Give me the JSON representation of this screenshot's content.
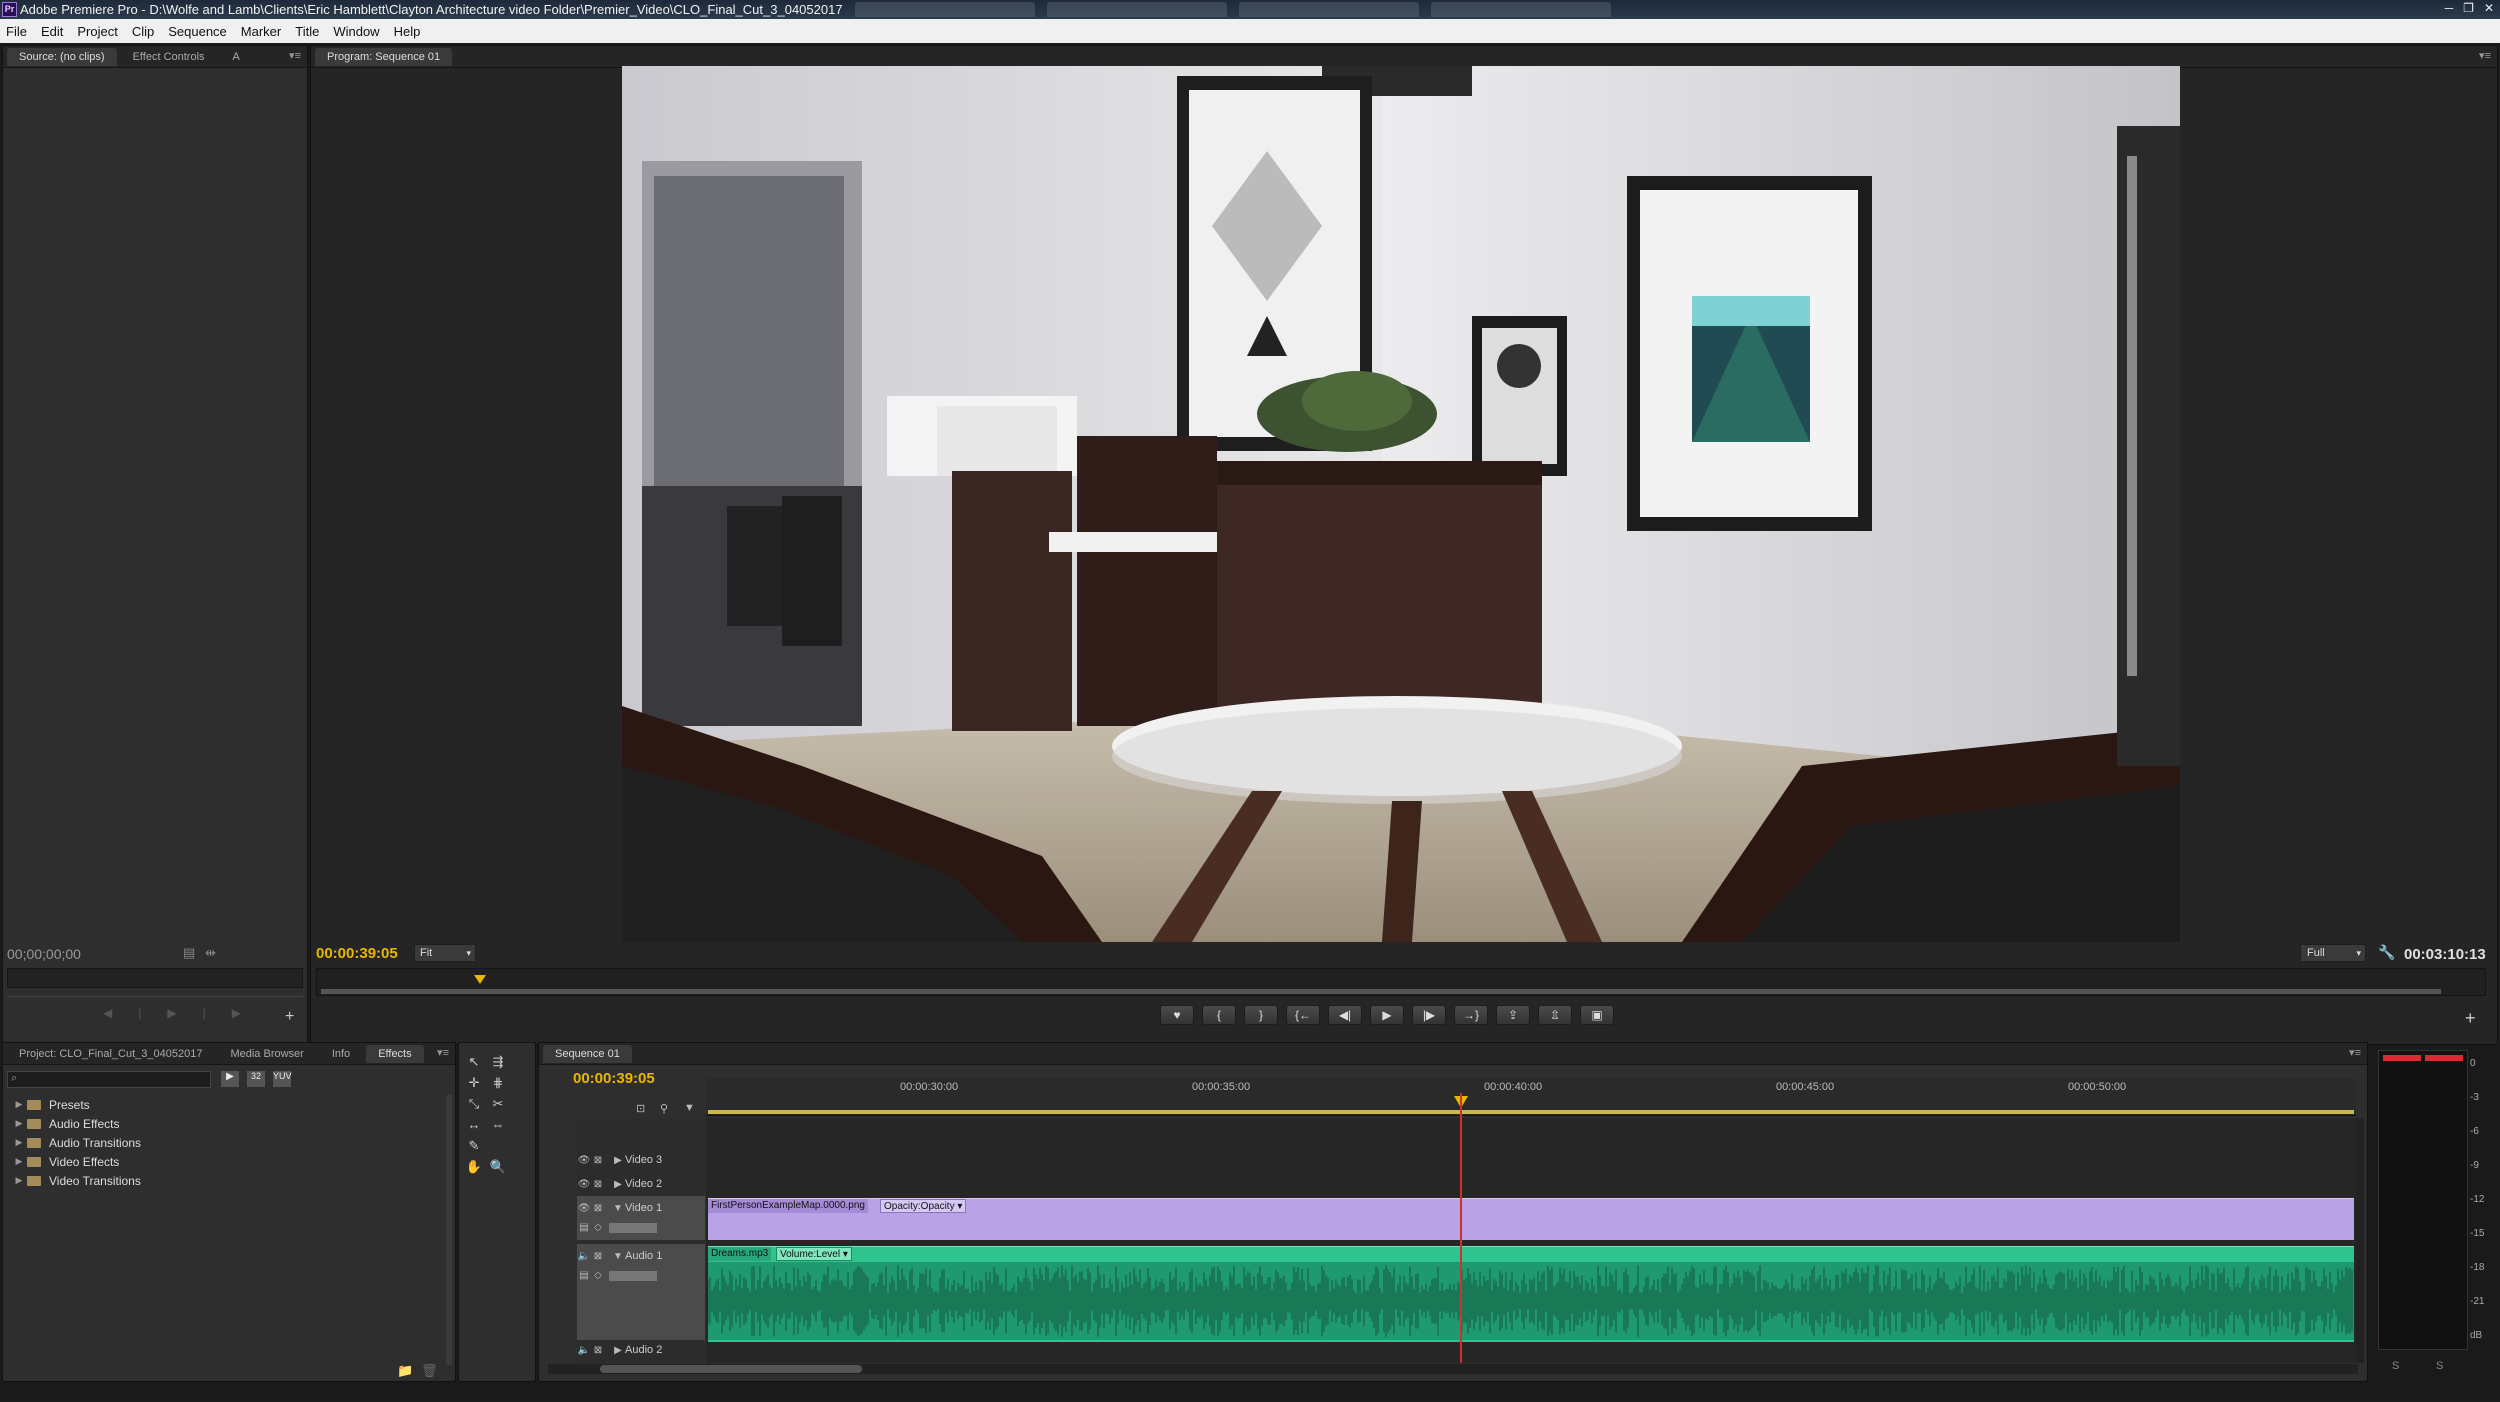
{
  "window": {
    "title": "Adobe Premiere Pro - D:\\Wolfe and Lamb\\Clients\\Eric Hamblett\\Clayton Architecture video Folder\\Premier_Video\\CLO_Final_Cut_3_04052017",
    "app_icon": "Pr",
    "controls": {
      "minimize": "─",
      "restore": "❐",
      "close": "✕"
    }
  },
  "menu": [
    "File",
    "Edit",
    "Project",
    "Clip",
    "Sequence",
    "Marker",
    "Title",
    "Window",
    "Help"
  ],
  "source_panel": {
    "tabs": [
      "Source: (no clips)",
      "Effect Controls"
    ],
    "extra_tab": "A",
    "timecode": "00;00;00;00",
    "icons": [
      "settings-icon",
      "export-frame-icon"
    ]
  },
  "program_panel": {
    "tab": "Program: Sequence 01",
    "timecode_current": "00:00:39:05",
    "fit": "Fit",
    "resolution": "Full",
    "duration": "00:03:10:13",
    "playhead_fraction": 0.075,
    "controls": [
      "♥",
      "{",
      "}",
      "{←",
      "◀|",
      "▶",
      "|▶",
      "→}",
      "⇪",
      "⇫",
      "▣"
    ]
  },
  "project_panel": {
    "tabs": [
      "Project: CLO_Final_Cut_3_04052017",
      "Media Browser",
      "Info",
      "Effects"
    ],
    "active_tab": "Effects",
    "search_placeholder": "",
    "tree": [
      "Presets",
      "Audio Effects",
      "Audio Transitions",
      "Video Effects",
      "Video Transitions"
    ]
  },
  "timeline": {
    "tab": "Sequence 01",
    "timecode": "00:00:39:05",
    "ruler": [
      "00:00:30:00",
      "00:00:35:00",
      "00:00:40:00",
      "00:00:45:00",
      "00:00:50:00"
    ],
    "tracks": {
      "video3": "Video 3",
      "video2": "Video 2",
      "video1": "Video 1",
      "audio1": "Audio 1",
      "audio2": "Audio 2"
    },
    "clips": {
      "video_clip": "FirstPersonExampleMap.0000.png",
      "video_effect": "Opacity:Opacity ▾",
      "audio_clip": "Dreams.mp3",
      "audio_effect": "Volume:Level ▾"
    }
  },
  "audio_meters": {
    "labels": [
      "0",
      "-3",
      "-6",
      "-9",
      "-12",
      "-15",
      "-18",
      "-21",
      "dB"
    ]
  },
  "colors": {
    "timecode": "#e6b800",
    "video_clip": "#b9a3e6",
    "audio_clip": "#2fc48f",
    "playhead": "#d03030"
  }
}
